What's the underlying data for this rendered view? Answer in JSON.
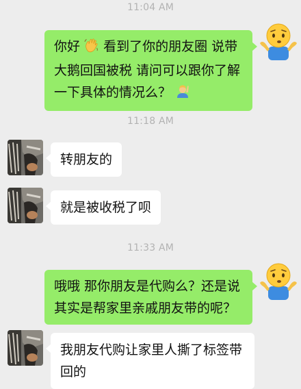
{
  "conversation": {
    "messages": [
      {
        "type": "time",
        "text": "11:04 AM"
      },
      {
        "type": "outgoing",
        "text_before_emoji": "你好",
        "emoji_1": "waving-hand-icon",
        "text_after_emoji": "看到了你的朋友圈 说带大鹅回国被税 请问可以跟你了解一下具体的情况么？",
        "emoji_2": "person-raising-hand-icon",
        "avatar": "shrug-emoji-avatar"
      },
      {
        "type": "time",
        "text": "11:18 AM"
      },
      {
        "type": "incoming",
        "text": "转朋友的",
        "avatar": "contact-photo-avatar"
      },
      {
        "type": "incoming",
        "text": "就是被收税了呗",
        "avatar": "contact-photo-avatar"
      },
      {
        "type": "time",
        "text": "11:33 AM"
      },
      {
        "type": "outgoing",
        "text": "哦哦 那你朋友是代购么？还是说其实是帮家里亲戚朋友带的呢？",
        "avatar": "shrug-emoji-avatar"
      },
      {
        "type": "incoming",
        "text": "我朋友代购让家里人撕了标签带回的",
        "avatar": "contact-photo-avatar"
      }
    ]
  },
  "colors": {
    "background": "#ededed",
    "outgoing_bubble": "#95ec69",
    "incoming_bubble": "#ffffff",
    "timestamp_text": "#b2b2b2"
  }
}
